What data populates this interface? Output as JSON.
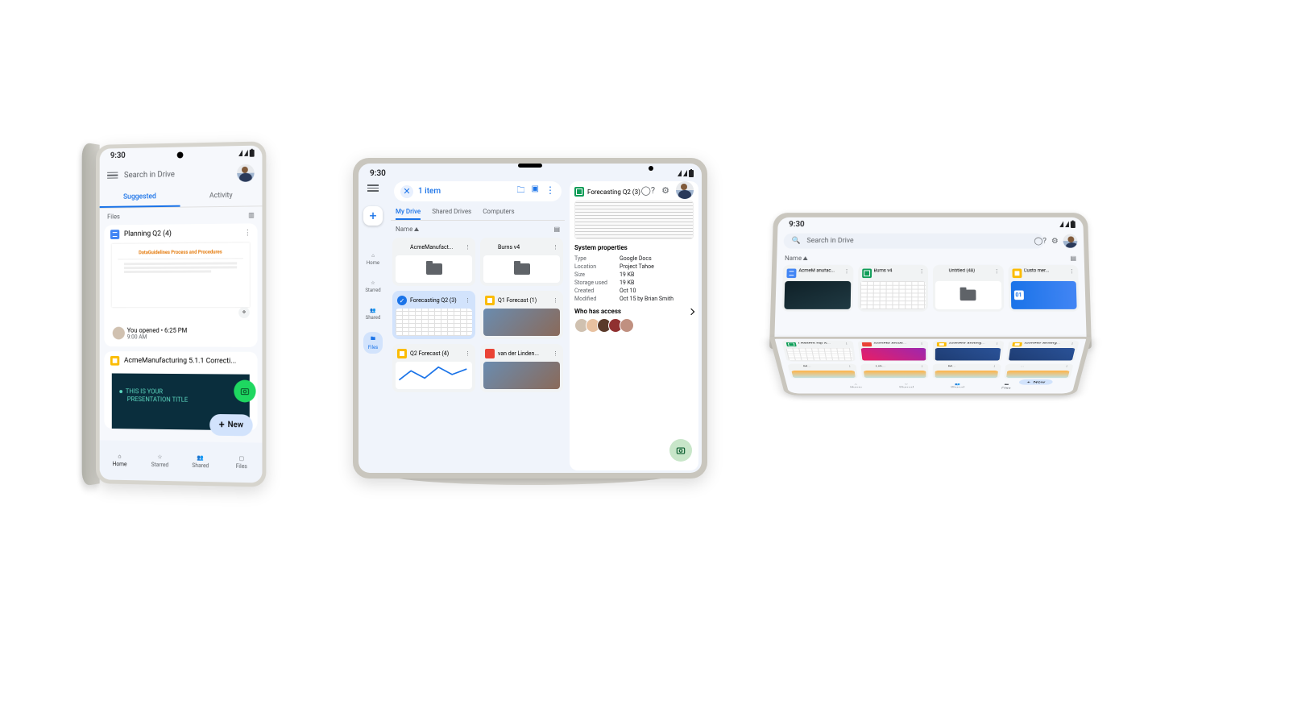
{
  "clock": "9:30",
  "phone": {
    "search_placeholder": "Search in Drive",
    "tabs": {
      "suggested": "Suggested",
      "activity": "Activity"
    },
    "section_label": "Files",
    "card1": {
      "title": "Planning Q2 (4)",
      "preview_title": "DataGuidelines Process and Procedures",
      "opened_label": "You opened",
      "opened_sep": "•",
      "opened_time": "6:25 PM",
      "opened_sub": "9:00 AM"
    },
    "card2": {
      "title": "AcmeManufacturing 5.1.1 Correcti...",
      "preview_line1": "THIS IS YOUR",
      "preview_line2": "PRESENTATION TITLE"
    },
    "fab_new": "New",
    "nav": {
      "home": "Home",
      "starred": "Starred",
      "shared": "Shared",
      "files": "Files"
    }
  },
  "tablet": {
    "selection": "1 item",
    "sidebar": {
      "home": "Home",
      "starred": "Starred",
      "shared": "Shared",
      "files": "Files"
    },
    "tabs": {
      "my_drive": "My Drive",
      "shared_drives": "Shared Drives",
      "computers": "Computers"
    },
    "name_label": "Name",
    "files": [
      {
        "name": "AcmeManufact...",
        "type": "folder"
      },
      {
        "name": "Burns v4",
        "type": "folder"
      },
      {
        "name": "Forecasting Q2 (3)",
        "type": "sheets",
        "selected": true
      },
      {
        "name": "Q1 Forecast (1)",
        "type": "slides",
        "thumb": "photo"
      },
      {
        "name": "Q2 Forecast (4)",
        "type": "slides",
        "thumb": "line"
      },
      {
        "name": "van der Linden...",
        "type": "pdf",
        "thumb": "photo"
      }
    ],
    "panel": {
      "title": "Forecasting Q2 (3)",
      "section1": "System properties",
      "props": [
        {
          "k": "Type",
          "v": "Google Docs"
        },
        {
          "k": "Location",
          "v": "Project Tahoe"
        },
        {
          "k": "Size",
          "v": "19 KB"
        },
        {
          "k": "Storage used",
          "v": "19 KB"
        },
        {
          "k": "Created",
          "v": "Oct 10"
        },
        {
          "k": "Modified",
          "v": "Oct 15 by Brian Smith"
        }
      ],
      "access_label": "Who has access"
    }
  },
  "fold": {
    "search_placeholder": "Search in Drive",
    "name_label": "Name",
    "row1": [
      {
        "name": "AcmeM anufac...",
        "type": "docs",
        "thumb": "dark"
      },
      {
        "name": "Burns v4",
        "type": "sheets",
        "thumb": "sheet"
      },
      {
        "name": "Untitled (48)",
        "thumb": "folder"
      },
      {
        "name": "Custo mer...",
        "type": "slides",
        "thumb": "blue",
        "badge": "01"
      }
    ],
    "row2": [
      {
        "name": "Leaders hip &...",
        "type": "sheets",
        "thumb": "sheet"
      },
      {
        "name": "AcmeM anual...",
        "type": "pdf",
        "thumb": "brand1"
      },
      {
        "name": "AcmeBr anding...",
        "type": "slides",
        "thumb": "brand2"
      },
      {
        "name": "AcmeBr anding...",
        "type": "slides",
        "thumb": "brand2"
      }
    ],
    "row3": [
      {
        "name": "M..."
      },
      {
        "name": "Lin..."
      },
      {
        "name": "M..."
      },
      {
        "name": "..."
      }
    ],
    "fab_new": "New",
    "nav": {
      "home": "Home",
      "starred": "Starred",
      "shared": "Shared",
      "files": "Files"
    }
  }
}
